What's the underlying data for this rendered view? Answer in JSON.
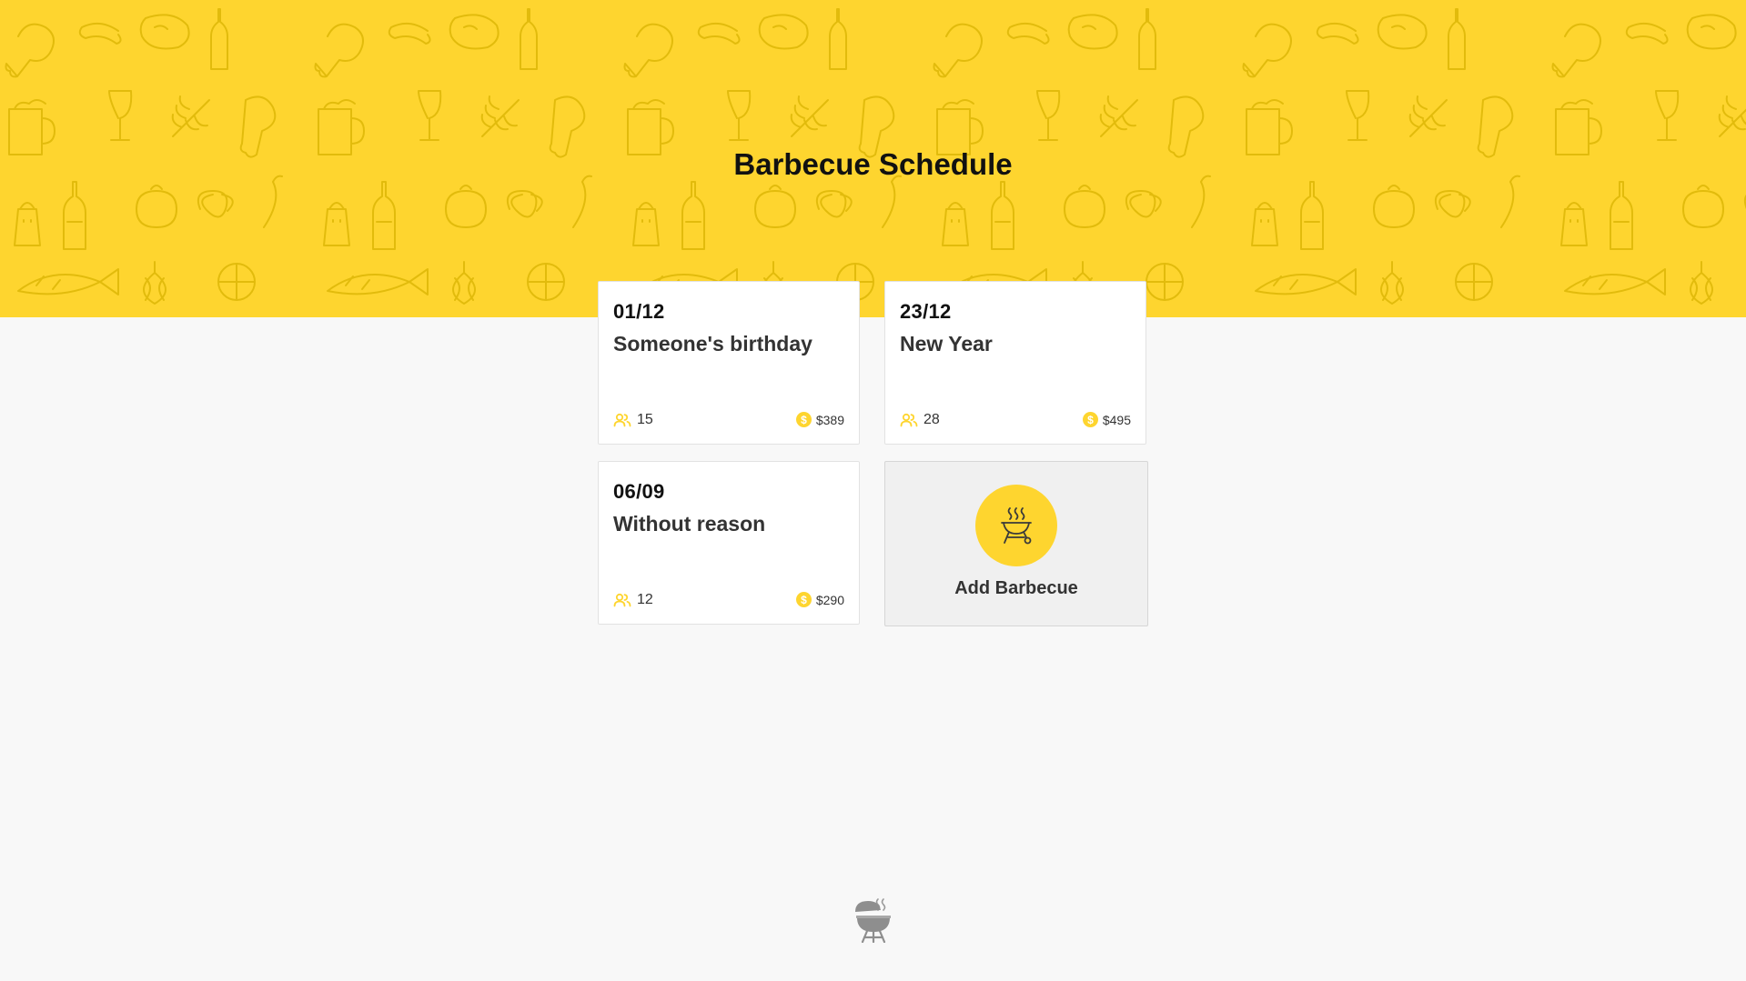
{
  "header": {
    "title": "Barbecue Schedule"
  },
  "barbecues": [
    {
      "date": "01/12",
      "title": "Someone's birthday",
      "participants": "15",
      "amount": "$389"
    },
    {
      "date": "23/12",
      "title": "New Year",
      "participants": "28",
      "amount": "$495"
    },
    {
      "date": "06/09",
      "title": "Without reason",
      "participants": "12",
      "amount": "$290"
    }
  ],
  "add_card": {
    "label": "Add Barbecue",
    "icon": "grill-icon"
  },
  "icons": {
    "participants": "people-icon",
    "amount": "money-icon",
    "footer": "bbq-logo-icon"
  },
  "colors": {
    "accent": "#fed52f",
    "background": "#f8f8f8",
    "card": "#ffffff",
    "add_card": "#f0f0f0",
    "text": "#333333"
  }
}
